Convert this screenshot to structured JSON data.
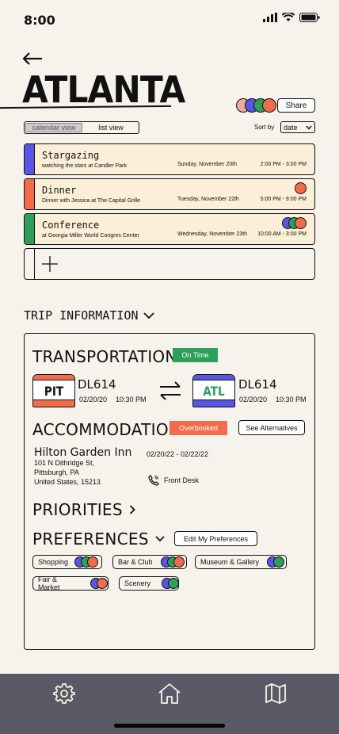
{
  "status": {
    "time": "8:00"
  },
  "header": {
    "city": "ATLANTA",
    "share_label": "Share"
  },
  "colors": {
    "blue": "#5a55e6",
    "red": "#f26b4b",
    "green": "#2f9e5b",
    "pink": "#f0a99a",
    "cream": "#fbefd8",
    "navbar": "#5a5966"
  },
  "view_toggle": {
    "calendar": "calendar view",
    "list": "list view"
  },
  "sort": {
    "label": "Sort by",
    "value": "date"
  },
  "events": [
    {
      "title": "Stargazing",
      "subtitle": "watching the stars at Candler Park",
      "date": "Sunday, November 20th",
      "time": "2:00 PM - 3:00 PM",
      "color": "#5a55e6"
    },
    {
      "title": "Dinner",
      "subtitle": "Dinner with Jessica at The Capital Grille",
      "date": "Tuesday, November 22th",
      "time": "5:00 PM - 9:00 PM",
      "color": "#f26b4b"
    },
    {
      "title": "Conference",
      "subtitle": "at Georgia Miller World Congres Center",
      "date": "Wednesday, November 23th",
      "time": "10:00 AM - 3:00 PM",
      "color": "#2f9e5b"
    }
  ],
  "add_event_icon": "plus-icon",
  "trip": {
    "heading": "TRIP INFORMATION",
    "transportation": {
      "heading": "TRANSPORTATION",
      "status": "On Time",
      "from": {
        "code": "PIT",
        "flight": "DL614",
        "date": "02/20/20",
        "time": "10:30 PM"
      },
      "to": {
        "code": "ATL",
        "flight": "DL614",
        "date": "02/20/20",
        "time": "10:30 PM"
      }
    },
    "accommodation": {
      "heading": "ACCOMMODATION",
      "status": "Overbooked",
      "alt_button": "See Alternatives",
      "hotel": "Hilton Garden Inn",
      "address_line1": "101 N Dithridge St,",
      "address_line2": "Pittsburgh, PA",
      "address_line3": "United States, 15213",
      "dates": "02/20/22 - 02/22/22",
      "front_desk": "Front Desk"
    },
    "priorities": {
      "heading": "PRIORITIES"
    },
    "preferences": {
      "heading": "PREFERENCES",
      "edit_button": "Edit My Preferences",
      "chips": [
        {
          "label": "Shopping"
        },
        {
          "label": "Bar & Club"
        },
        {
          "label": "Museum & Gallery"
        },
        {
          "label": "Fair & Market"
        },
        {
          "label": "Scenery"
        }
      ]
    }
  },
  "nav": {
    "settings_icon": "gear-icon",
    "home_icon": "home-icon",
    "map_icon": "map-icon"
  }
}
